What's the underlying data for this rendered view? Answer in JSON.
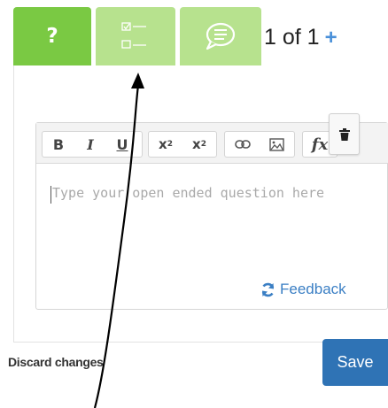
{
  "tabs": [
    {
      "label": "?",
      "icon": "question-icon",
      "active": true
    },
    {
      "icon": "multiple-choice-icon"
    },
    {
      "icon": "speech-bubble-icon"
    }
  ],
  "pagination": {
    "text": "1 of 1",
    "add_symbol": "+"
  },
  "toolbar": {
    "bold": "B",
    "italic": "I",
    "underline": "U",
    "superscript": "x",
    "superscript_mark": "2",
    "subscript": "x",
    "subscript_mark": "2",
    "formula": "fx"
  },
  "editor": {
    "placeholder": "Type your open ended question here"
  },
  "feedback": {
    "label": "Feedback"
  },
  "actions": {
    "discard_label": "Discard changes",
    "save_label": "Save"
  },
  "colors": {
    "tab_active": "#7ac943",
    "tab_inactive": "#b7e28e",
    "accent_blue": "#2f73b5",
    "link_blue": "#3b7fc4"
  }
}
